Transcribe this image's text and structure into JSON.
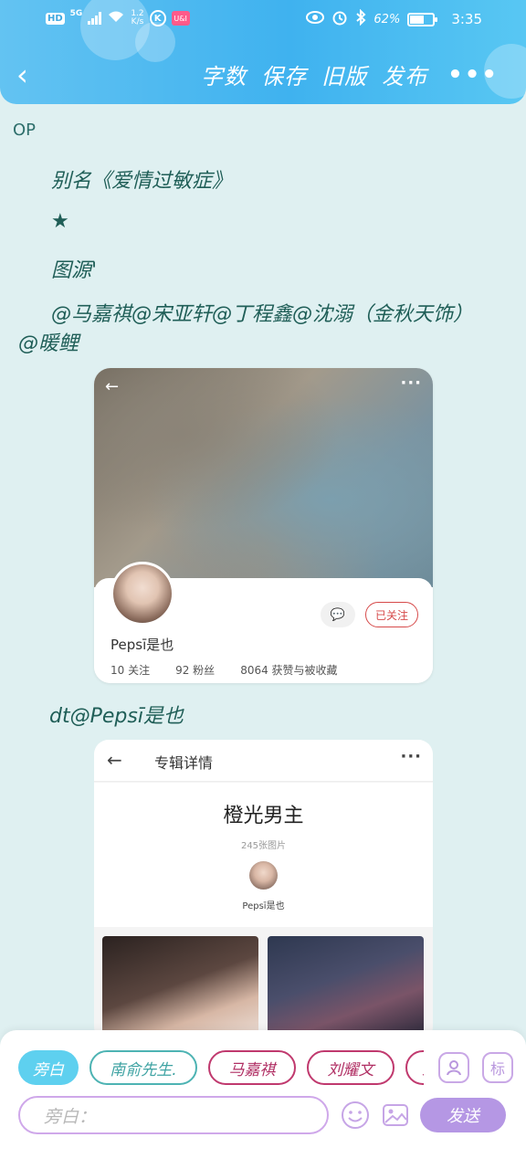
{
  "status_bar": {
    "hd": "HD",
    "network": "5G",
    "speed_value": "1.2",
    "speed_unit": "K/s",
    "k_label": "K",
    "app_badge": "U&I",
    "battery": "62%",
    "battery_level": 0.62,
    "time": "3:35"
  },
  "header": {
    "back": "‹",
    "actions": [
      "字数",
      "保存",
      "旧版",
      "发布"
    ],
    "more": "•••"
  },
  "document": {
    "label": "OP",
    "lines": {
      "alias": "别名《爱情过敏症》",
      "star": "★",
      "source": "图源'",
      "mentions": "@马嘉祺@宋亚轩@丁程鑫@沈溺（金秋天饰）",
      "mention_extra": "@暖鲤",
      "dt": "dt@Pepsī是也"
    }
  },
  "profile_card": {
    "back": "←",
    "more": "···",
    "message_icon": "💬",
    "follow_status": "已关注",
    "username": "Pepsī是也",
    "stats": [
      "10 关注",
      "92 粉丝",
      "8064 获赞与被收藏"
    ]
  },
  "album_card": {
    "back": "←",
    "nav_title": "专辑详情",
    "more": "···",
    "album_title": "橙光男主",
    "photo_count": "245张图片",
    "owner": "Pepsī是也"
  },
  "editor": {
    "chips": [
      "旁白",
      "南俞先生.",
      "马嘉祺",
      "刘耀文",
      "宋"
    ],
    "active_chip": "旁白",
    "side_icons": [
      "person-icon",
      "tag-icon"
    ],
    "tag_icon_label": "标",
    "input_placeholder": "旁白：",
    "emoji": "☺",
    "send": "发送"
  },
  "colors": {
    "header_accent": "#3fb2ef",
    "background": "#dff0f1",
    "text_green": "#1f5e57",
    "chip_active": "#5ed0ef",
    "chip_pink": "#c0396e",
    "send_purple": "#b597e4"
  }
}
